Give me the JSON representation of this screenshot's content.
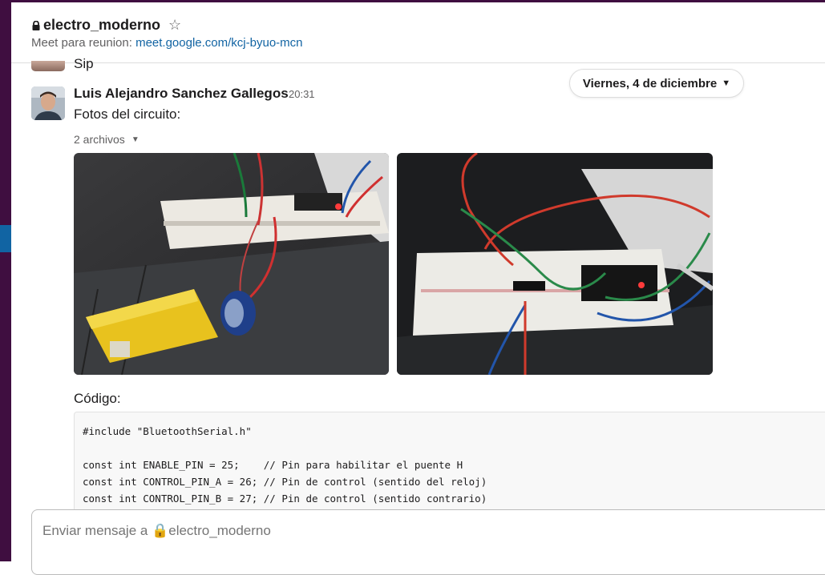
{
  "channel": {
    "name": "electro_moderno",
    "topic_prefix": "Meet para reunion: ",
    "topic_link": "meet.google.com/kcj-byuo-mcn"
  },
  "previous_message": {
    "text": "Sip"
  },
  "date_divider": {
    "label": "Viernes, 4 de diciembre"
  },
  "message": {
    "sender": "Luis Alejandro Sanchez Gallegos",
    "time": "20:31",
    "text": "Fotos del circuito:",
    "files_label": "2 archivos",
    "code_label": "Código:",
    "code_lines": [
      "#include \"BluetoothSerial.h\"",
      "",
      "const int ENABLE_PIN = 25;    // Pin para habilitar el puente H",
      "const int CONTROL_PIN_A = 26; // Pin de control (sentido del reloj)",
      "const int CONTROL_PIN_B = 27; // Pin de control (sentido contrario)"
    ]
  },
  "composer": {
    "placeholder": "Enviar mensaje a 🔒electro_moderno"
  },
  "colors": {
    "sidebar": "#3f0e40",
    "link": "#1264a3",
    "active": "#1164a3"
  },
  "icons": [
    "lock-icon",
    "star-icon",
    "chevron-down-icon",
    "caret-down-icon"
  ]
}
